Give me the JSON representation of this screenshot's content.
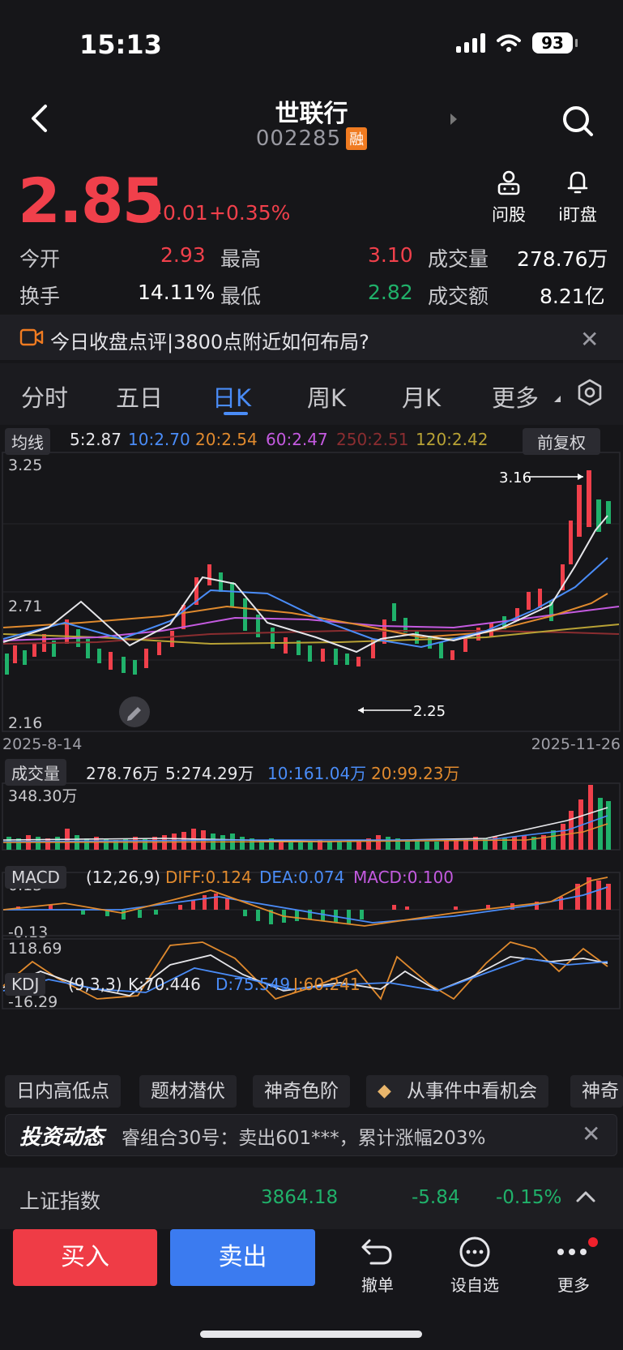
{
  "status": {
    "time": "15:13",
    "battery": "93"
  },
  "header": {
    "title": "世联行",
    "code": "002285",
    "badge": "融"
  },
  "quote": {
    "price": "2.85",
    "change": "+0.01",
    "change_pct": "+0.35%",
    "actions": {
      "ask": "问股",
      "watch": "i盯盘"
    }
  },
  "stats": {
    "open_label": "今开",
    "open": "2.93",
    "high_label": "最高",
    "high": "3.10",
    "volume_label": "成交量",
    "volume": "278.76万",
    "turnover_label": "换手",
    "turnover": "14.11%",
    "low_label": "最低",
    "low": "2.82",
    "amount_label": "成交额",
    "amount": "8.21亿"
  },
  "news": {
    "text": "今日收盘点评|3800点附近如何布局?"
  },
  "tabs": [
    "分时",
    "五日",
    "日K",
    "周K",
    "月K",
    "更多"
  ],
  "ma": {
    "chip": "均线",
    "ma5": "5:2.87",
    "ma10": "10:2.70",
    "ma20": "20:2.54",
    "ma60": "60:2.47",
    "ma250": "250:2.51",
    "ma120": "120:2.42",
    "adjust": "前复权"
  },
  "kchart": {
    "y_top": "3.25",
    "y_mid": "2.71",
    "y_bottom": "2.16",
    "date_start": "2025-8-14",
    "date_end": "2025-11-26",
    "high_mark": "3.16",
    "low_mark": "2.25"
  },
  "volume": {
    "chip": "成交量",
    "current": "278.76万",
    "ma5": "5:274.29万",
    "ma10": "10:161.04万",
    "ma20": "20:99.23万",
    "y_top": "348.30万"
  },
  "macd": {
    "chip": "MACD",
    "params": "(12,26,9)",
    "diff": "DIFF:0.124",
    "dea": "DEA:0.074",
    "macd": "MACD:0.100",
    "y_top": "0.13",
    "y_bottom": "-0.13"
  },
  "kdj": {
    "chip": "KDJ",
    "params": "(9,3,3)",
    "k": "K:70.446",
    "d": "D:75.549",
    "j": "J:60.241",
    "y_top": "118.69",
    "y_bottom": "-16.29"
  },
  "chips": [
    "日内高低点",
    "题材潜伏",
    "神奇色阶",
    "从事件中看机会",
    "神奇"
  ],
  "dynamics": {
    "title": "投资动态",
    "text": "睿组合30号：卖出601***，累计涨幅203%"
  },
  "index": {
    "name": "上证指数",
    "value": "3864.18",
    "change": "-5.84",
    "pct": "-0.15%"
  },
  "bottom": {
    "buy": "买入",
    "sell": "卖出",
    "cancel": "撤单",
    "favorite": "设自选",
    "more": "更多"
  },
  "colors": {
    "up": "#f0404b",
    "down": "#20b16a",
    "accent": "#4a8cf7",
    "background": "#161619"
  }
}
